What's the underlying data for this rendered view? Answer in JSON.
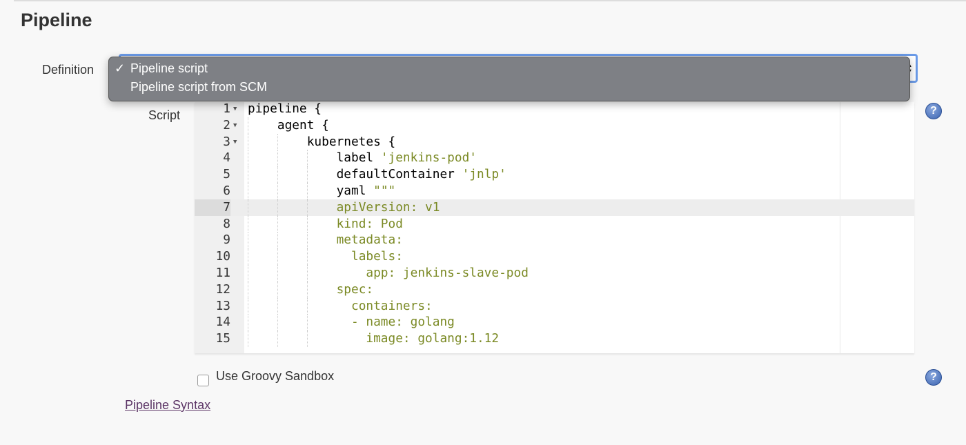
{
  "section_title": "Pipeline",
  "definition": {
    "label": "Definition",
    "options": [
      "Pipeline script",
      "Pipeline script from SCM"
    ],
    "selected": "Pipeline script"
  },
  "script": {
    "label": "Script",
    "active_line": 7,
    "lines": [
      {
        "n": "1",
        "fold": true,
        "indent": 0,
        "parts": [
          [
            "k",
            "pipeline {"
          ]
        ]
      },
      {
        "n": "2",
        "fold": true,
        "indent": 1,
        "parts": [
          [
            "k",
            "agent {"
          ]
        ]
      },
      {
        "n": "3",
        "fold": true,
        "indent": 2,
        "parts": [
          [
            "k",
            "kubernetes {"
          ]
        ]
      },
      {
        "n": "4",
        "indent": 3,
        "parts": [
          [
            "k",
            "label "
          ],
          [
            "s",
            "'jenkins-pod'"
          ]
        ]
      },
      {
        "n": "5",
        "indent": 3,
        "parts": [
          [
            "k",
            "defaultContainer "
          ],
          [
            "s",
            "'jnlp'"
          ]
        ]
      },
      {
        "n": "6",
        "indent": 3,
        "parts": [
          [
            "k",
            "yaml "
          ],
          [
            "s",
            "\"\"\""
          ]
        ]
      },
      {
        "n": "7",
        "indent": 3,
        "parts": [
          [
            "s",
            "apiVersion: v1"
          ]
        ]
      },
      {
        "n": "8",
        "indent": 3,
        "parts": [
          [
            "s",
            "kind: Pod"
          ]
        ]
      },
      {
        "n": "9",
        "indent": 3,
        "parts": [
          [
            "s",
            "metadata:"
          ]
        ]
      },
      {
        "n": "10",
        "indent": 3,
        "parts": [
          [
            "s",
            "  labels:"
          ]
        ]
      },
      {
        "n": "11",
        "indent": 3,
        "parts": [
          [
            "s",
            "    app: jenkins-slave-pod"
          ]
        ]
      },
      {
        "n": "12",
        "indent": 3,
        "parts": [
          [
            "s",
            "spec:"
          ]
        ]
      },
      {
        "n": "13",
        "indent": 3,
        "parts": [
          [
            "s",
            "  containers:"
          ]
        ]
      },
      {
        "n": "14",
        "indent": 3,
        "parts": [
          [
            "s",
            "  - name: golang"
          ]
        ]
      },
      {
        "n": "15",
        "indent": 3,
        "parts": [
          [
            "s",
            "    image: golang:1.12"
          ]
        ]
      }
    ]
  },
  "sandbox": {
    "label": "Use Groovy Sandbox",
    "checked": false
  },
  "link": "Pipeline Syntax",
  "help_icon": "?",
  "colors": {
    "string": "#7b8a25",
    "focus": "#6b9be8",
    "menu": "#7e8085"
  }
}
